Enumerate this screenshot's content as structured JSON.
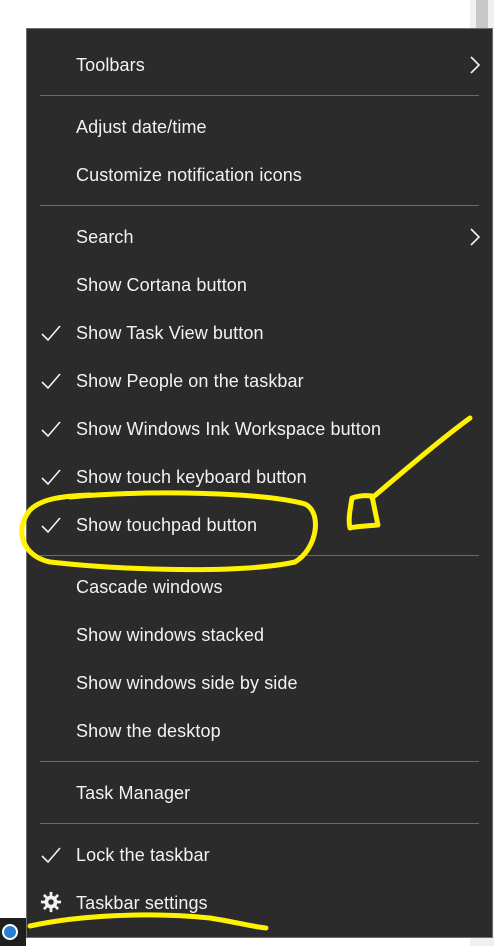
{
  "menu": {
    "items": [
      {
        "id": "toolbars",
        "label": "Toolbars",
        "submenu": true
      },
      {
        "id": "adjust-date-time",
        "label": "Adjust date/time"
      },
      {
        "id": "customize-notification-icons",
        "label": "Customize notification icons"
      },
      {
        "id": "search",
        "label": "Search",
        "submenu": true
      },
      {
        "id": "show-cortana-button",
        "label": "Show Cortana button"
      },
      {
        "id": "show-task-view-button",
        "label": "Show Task View button",
        "checked": true
      },
      {
        "id": "show-people",
        "label": "Show People on the taskbar",
        "checked": true
      },
      {
        "id": "show-windows-ink",
        "label": "Show Windows Ink Workspace button",
        "checked": true
      },
      {
        "id": "show-touch-keyboard",
        "label": "Show touch keyboard button",
        "checked": true
      },
      {
        "id": "show-touchpad-button",
        "label": "Show touchpad button",
        "checked": true
      },
      {
        "id": "cascade-windows",
        "label": "Cascade windows"
      },
      {
        "id": "show-windows-stacked",
        "label": "Show windows stacked"
      },
      {
        "id": "show-windows-side-by-side",
        "label": "Show windows side by side"
      },
      {
        "id": "show-the-desktop",
        "label": "Show the desktop"
      },
      {
        "id": "task-manager",
        "label": "Task Manager"
      },
      {
        "id": "lock-the-taskbar",
        "label": "Lock the taskbar",
        "checked": true
      },
      {
        "id": "taskbar-settings",
        "label": "Taskbar settings",
        "icon": "gear-icon"
      }
    ]
  },
  "colors": {
    "menu_background": "#2b2b2b",
    "menu_text": "#f2f2f2",
    "separator": "#6a6a6a",
    "annotation": "#fff200"
  }
}
